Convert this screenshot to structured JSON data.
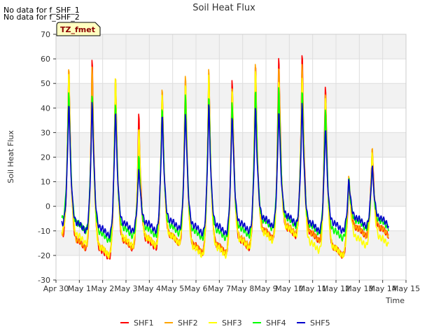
{
  "notes": [
    "No data for f_SHF_1",
    "No data for f_SHF_2"
  ],
  "chart_data": {
    "type": "line",
    "title": "Soil Heat Flux",
    "xlabel": "Time",
    "ylabel": "Soil Heat Flux",
    "badge": "TZ_fmet",
    "ylim": [
      -30,
      70
    ],
    "yticks": [
      -30,
      -20,
      -10,
      0,
      10,
      20,
      30,
      40,
      50,
      60,
      70
    ],
    "xlim": [
      0,
      15
    ],
    "xticks": [
      {
        "day": 0,
        "label": "Apr 30"
      },
      {
        "day": 1,
        "label": "May 1"
      },
      {
        "day": 2,
        "label": "May 2"
      },
      {
        "day": 3,
        "label": "May 3"
      },
      {
        "day": 4,
        "label": "May 4"
      },
      {
        "day": 5,
        "label": "May 5"
      },
      {
        "day": 6,
        "label": "May 6"
      },
      {
        "day": 7,
        "label": "May 7"
      },
      {
        "day": 8,
        "label": "May 8"
      },
      {
        "day": 9,
        "label": "May 9"
      },
      {
        "day": 10,
        "label": "May 10"
      },
      {
        "day": 11,
        "label": "May 11"
      },
      {
        "day": 12,
        "label": "May 12"
      },
      {
        "day": 13,
        "label": "May 13"
      },
      {
        "day": 14,
        "label": "May 14"
      },
      {
        "day": 15,
        "label": "May 15"
      }
    ],
    "grid": true,
    "legend_position": "bottom",
    "series": [
      {
        "name": "SHF1",
        "color": "#ff0000",
        "min": [
          -12,
          -17,
          -21,
          -17,
          -17,
          -15,
          -19,
          -19,
          -17,
          -13,
          -12,
          -14,
          -20,
          -12
        ],
        "max": [
          62,
          65,
          58,
          41,
          52,
          56,
          61,
          57,
          63,
          67,
          67,
          55,
          12,
          26
        ]
      },
      {
        "name": "SHF2",
        "color": "#ffa500",
        "min": [
          -11,
          -17,
          -20,
          -17,
          -16,
          -15,
          -19,
          -19,
          -16,
          -13,
          -11,
          -14,
          -20,
          -12
        ],
        "max": [
          62,
          63,
          58,
          33,
          52,
          60,
          61,
          55,
          63,
          63,
          63,
          51,
          15,
          26
        ]
      },
      {
        "name": "SHF3",
        "color": "#ffff00",
        "min": [
          -10,
          -15,
          -20,
          -16,
          -16,
          -15,
          -20,
          -20,
          -17,
          -14,
          -12,
          -18,
          -20,
          -16
        ],
        "max": [
          58,
          51,
          57,
          36,
          50,
          55,
          60,
          52,
          62,
          55,
          59,
          48,
          14,
          24
        ]
      },
      {
        "name": "SHF4",
        "color": "#00ff00",
        "min": [
          -5,
          -10,
          -14,
          -12,
          -12,
          -11,
          -13,
          -13,
          -12,
          -9,
          -8,
          -11,
          -13,
          -9
        ],
        "max": [
          51,
          49,
          47,
          22,
          45,
          49,
          50,
          46,
          52,
          53,
          51,
          44,
          12,
          18
        ]
      },
      {
        "name": "SHF5",
        "color": "#0000cc",
        "min": [
          -7,
          -10,
          -12,
          -10,
          -10,
          -9,
          -11,
          -11,
          -10,
          -8,
          -7,
          -10,
          -10,
          -8
        ],
        "max": [
          46,
          46,
          42,
          17,
          40,
          42,
          45,
          41,
          43,
          43,
          45,
          35,
          12,
          18
        ]
      }
    ]
  }
}
